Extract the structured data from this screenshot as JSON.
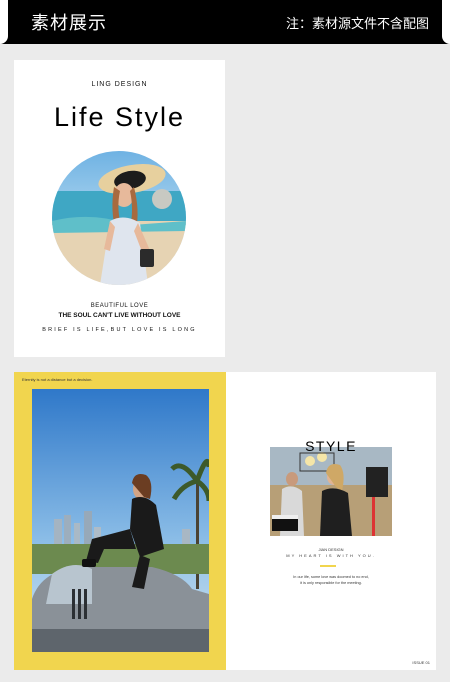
{
  "header": {
    "title": "素材展示",
    "note": "注：素材源文件不含配图"
  },
  "cover": {
    "brand": "LING DESIGN",
    "headline": "Life Style",
    "beautiful_love": "BEAUTIFUL LOVE",
    "soul": "THE SOUL CAN'T LIVE WITHOUT LOVE",
    "brief": "BRIEF IS LIFE,BUT LOVE IS LONG",
    "photo_alt": "woman-in-sun-hat-photo"
  },
  "spread": {
    "eternity": "Eternity is not a distance but a decision.",
    "style_word": "STYLE",
    "jian": "JIAN DESIGN",
    "heart": "MY HEART IS WITH YOU.",
    "love_line1": "In our life, some love was doomed to no end,",
    "love_line2": "it is only responsible for the meeting.",
    "issue": "ISSUE 01",
    "accent_color": "#f1d54e"
  }
}
